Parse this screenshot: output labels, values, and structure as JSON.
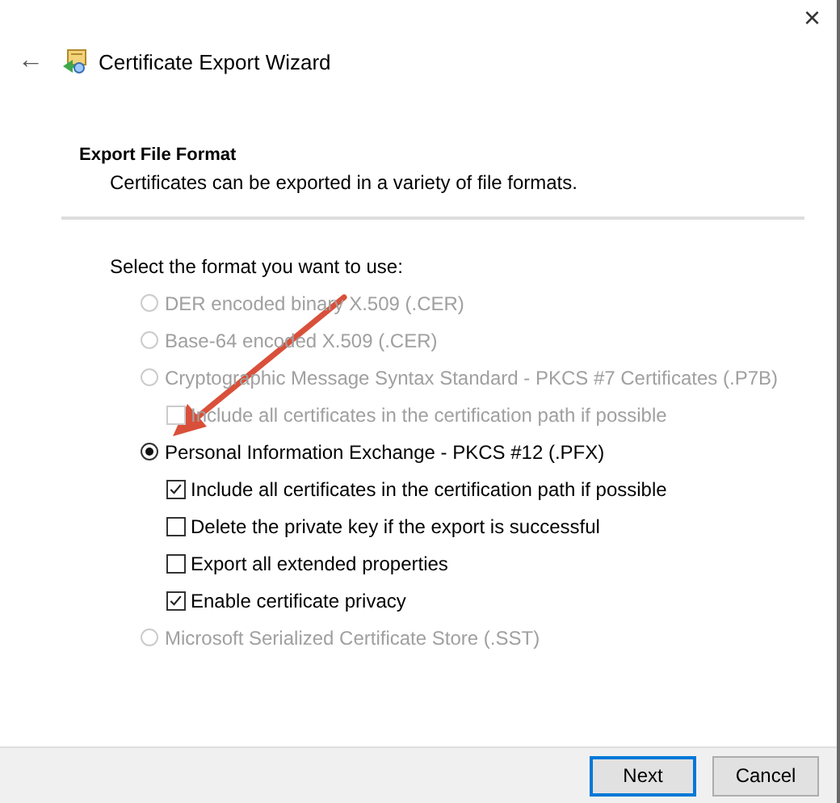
{
  "window": {
    "title": "Certificate Export Wizard",
    "close": "×",
    "back": "←"
  },
  "header": {
    "title": "Export File Format",
    "subtitle": "Certificates can be exported in a variety of file formats."
  },
  "prompt": "Select the format you want to use:",
  "formats": [
    {
      "label": "DER encoded binary X.509 (.CER)",
      "selected": false,
      "disabled": true
    },
    {
      "label": "Base-64 encoded X.509 (.CER)",
      "selected": false,
      "disabled": true
    },
    {
      "label": "Cryptographic Message Syntax Standard - PKCS #7 Certificates (.P7B)",
      "selected": false,
      "disabled": true,
      "checkboxes": [
        {
          "label": "Include all certificates in the certification path if possible",
          "checked": false,
          "disabled": true
        }
      ]
    },
    {
      "label": "Personal Information Exchange - PKCS #12 (.PFX)",
      "selected": true,
      "disabled": false,
      "checkboxes": [
        {
          "label": "Include all certificates in the certification path if possible",
          "checked": true,
          "disabled": false
        },
        {
          "label": "Delete the private key if the export is successful",
          "checked": false,
          "disabled": false
        },
        {
          "label": "Export all extended properties",
          "checked": false,
          "disabled": false
        },
        {
          "label": "Enable certificate privacy",
          "checked": true,
          "disabled": false
        }
      ]
    },
    {
      "label": "Microsoft Serialized Certificate Store (.SST)",
      "selected": false,
      "disabled": true
    }
  ],
  "buttons": [
    {
      "label": "Next",
      "default": true
    },
    {
      "label": "Cancel",
      "default": false
    }
  ]
}
